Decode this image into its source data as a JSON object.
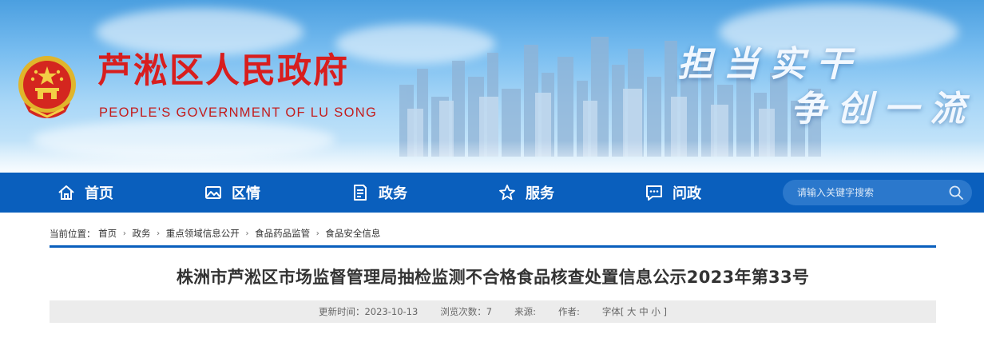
{
  "header": {
    "title": "芦淞区人民政府",
    "subtitle": "PEOPLE'S GOVERNMENT OF  LU SONG",
    "slogan_line1": "担当实干",
    "slogan_line2": "争创一流"
  },
  "nav": {
    "items": [
      {
        "label": "首页",
        "icon": "home-icon"
      },
      {
        "label": "区情",
        "icon": "picture-icon"
      },
      {
        "label": "政务",
        "icon": "document-icon"
      },
      {
        "label": "服务",
        "icon": "star-icon"
      },
      {
        "label": "问政",
        "icon": "chat-icon"
      }
    ],
    "search_placeholder": "请输入关键字搜索"
  },
  "breadcrumb": {
    "prefix": "当前位置：",
    "items": [
      "首页",
      "政务",
      "重点领域信息公开",
      "食品药品监管",
      "食品安全信息"
    ]
  },
  "article": {
    "title": "株洲市芦淞区市场监督管理局抽检监测不合格食品核查处置信息公示2023年第33号",
    "meta": {
      "updated": "更新时间：2023-10-13",
      "views": "浏览次数：7",
      "source": "来源:",
      "author": "作者:",
      "font_prefix": "字体[",
      "font_large": "大",
      "font_medium": "中",
      "font_small": "小",
      "font_suffix": "]"
    }
  },
  "colors": {
    "title_red": "#d81e1e",
    "nav_blue": "#0a5fbd"
  }
}
